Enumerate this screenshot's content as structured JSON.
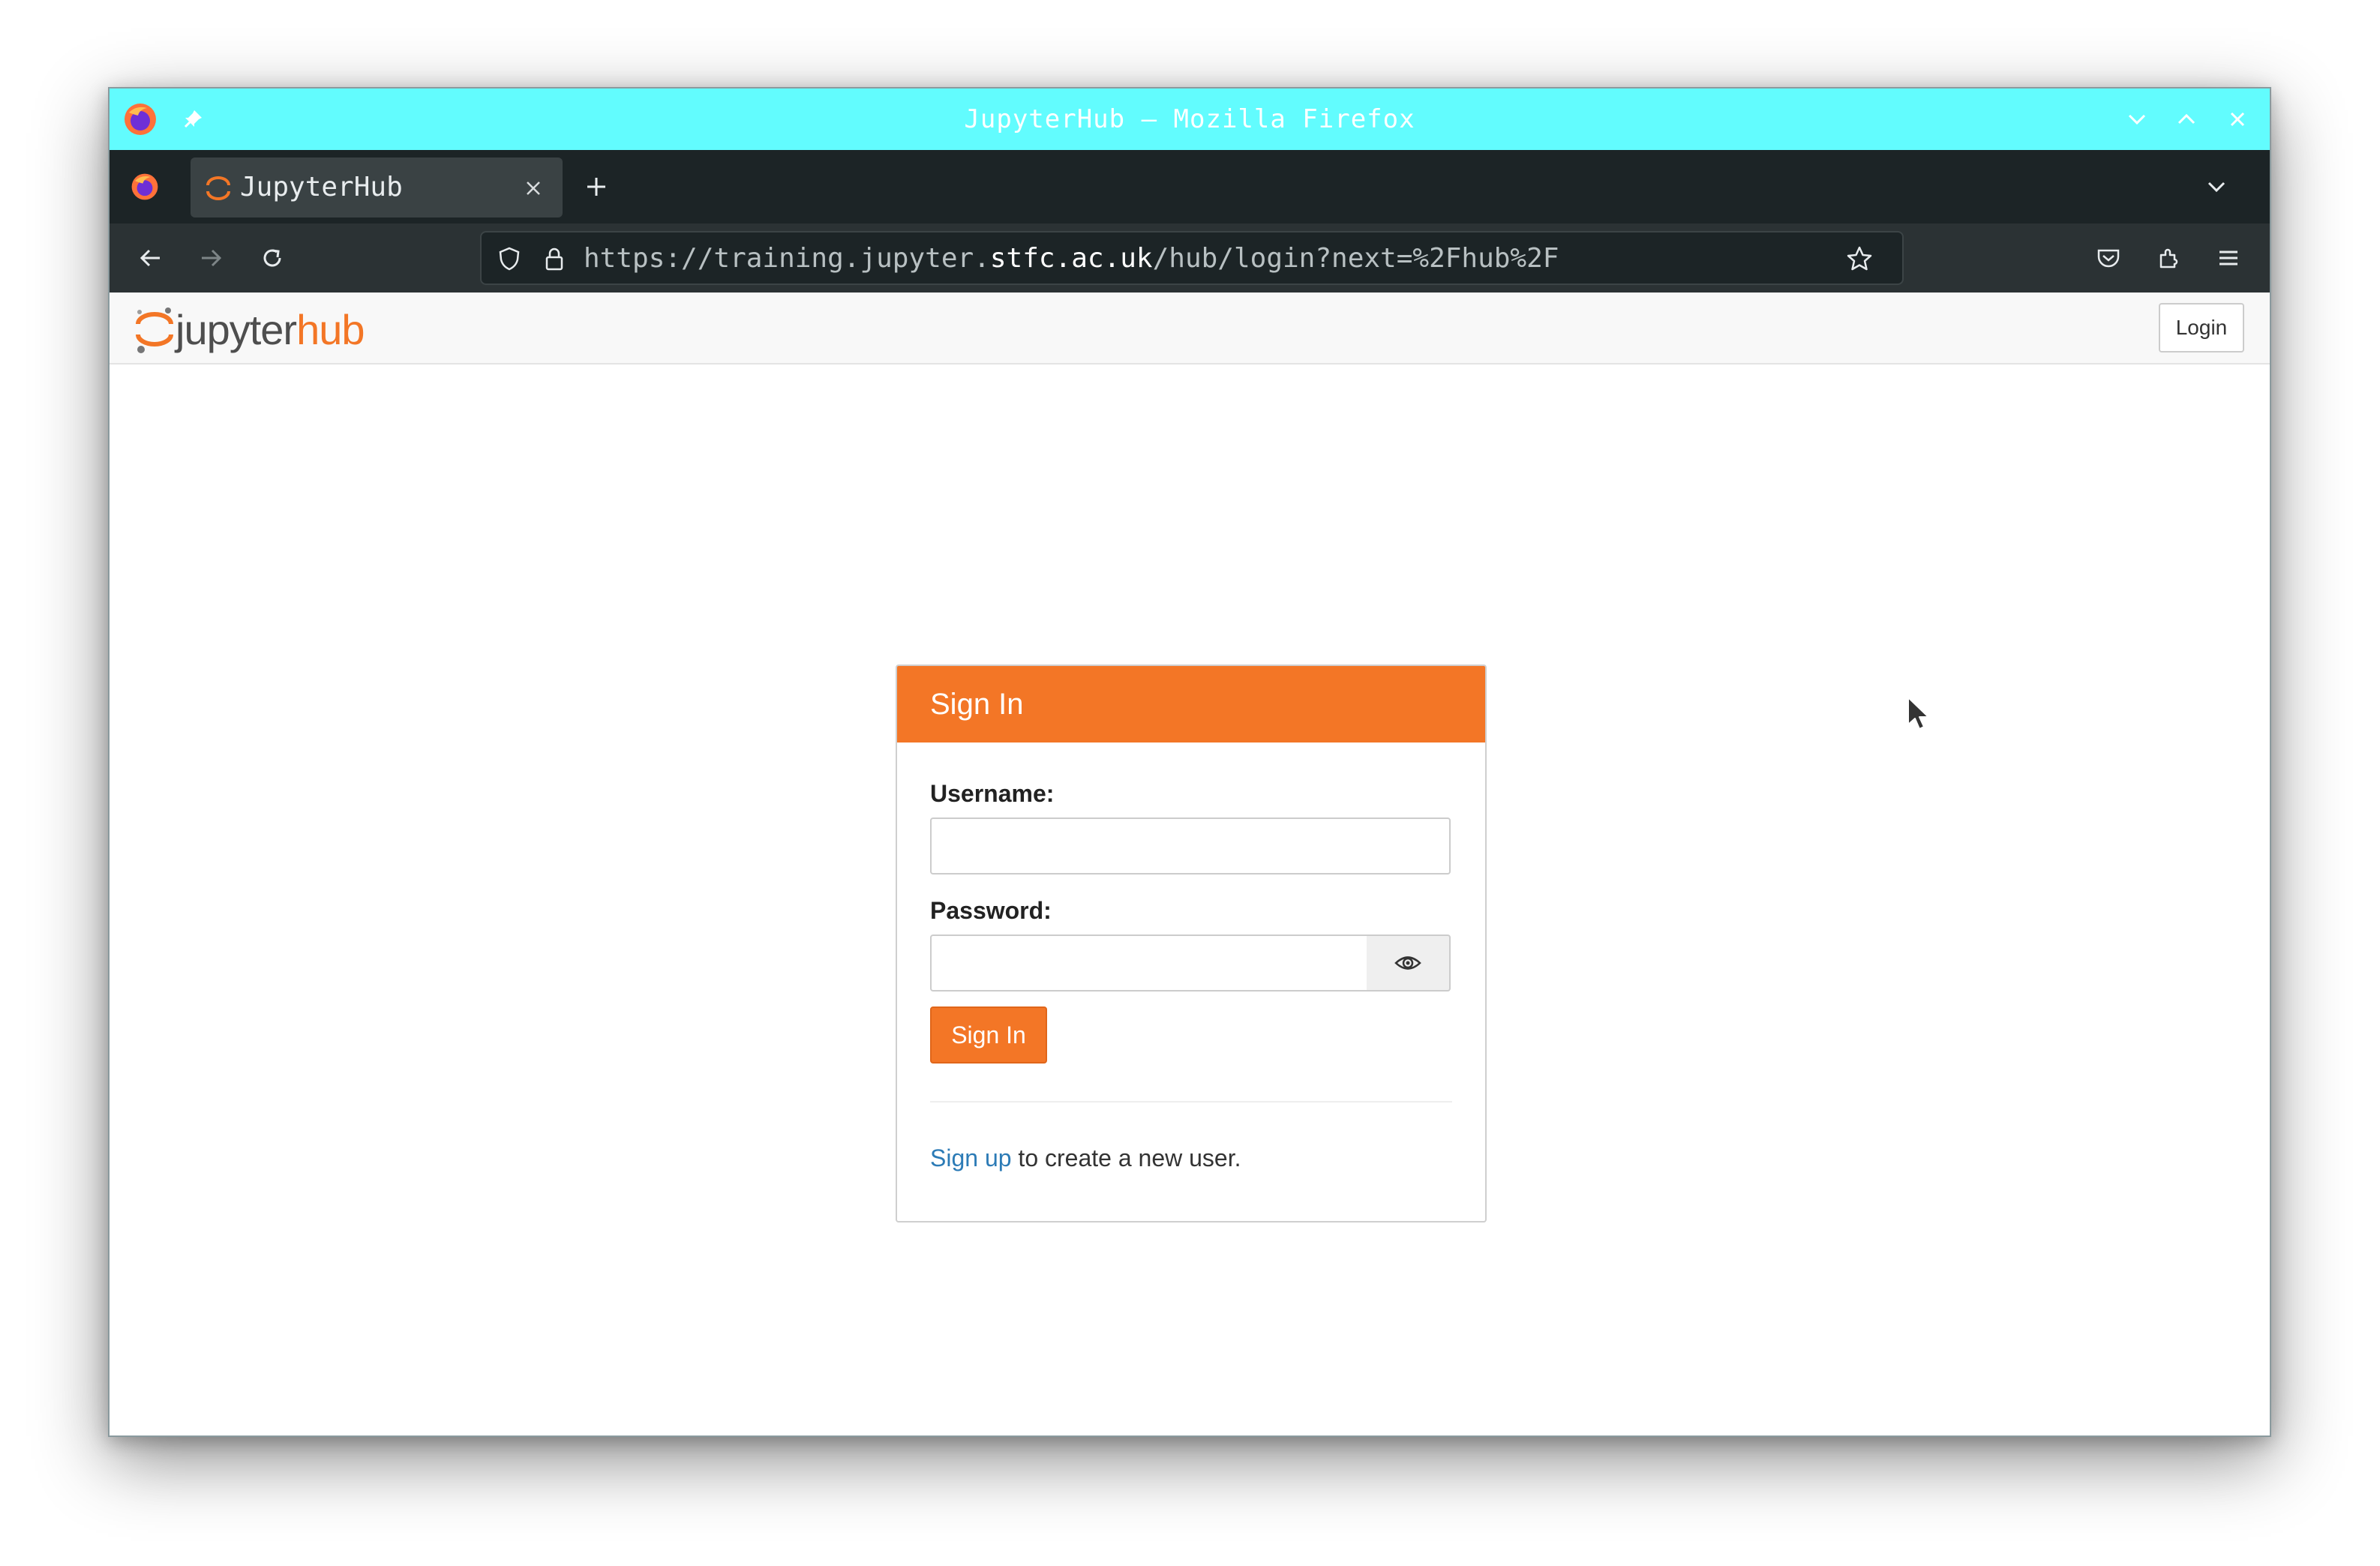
{
  "window": {
    "title": "JupyterHub — Mozilla Firefox"
  },
  "tabs": [
    {
      "label": "JupyterHub",
      "active": true
    }
  ],
  "navbar": {
    "url_prefix": "https://training.jupyter.",
    "url_host": "stfc.ac.uk",
    "url_path": "/hub/login?next=%2Fhub%2F"
  },
  "hub": {
    "logo_part1": "jupyter",
    "logo_part2": "hub",
    "login_button": "Login"
  },
  "login_form": {
    "heading": "Sign In",
    "username_label": "Username:",
    "username_value": "",
    "password_label": "Password:",
    "password_value": "",
    "submit_label": "Sign In",
    "signup_link": "Sign up",
    "signup_text": " to create a new user."
  },
  "colors": {
    "titlebar": "#62fcfe",
    "accent": "#f37626",
    "link": "#2c7bb6"
  }
}
